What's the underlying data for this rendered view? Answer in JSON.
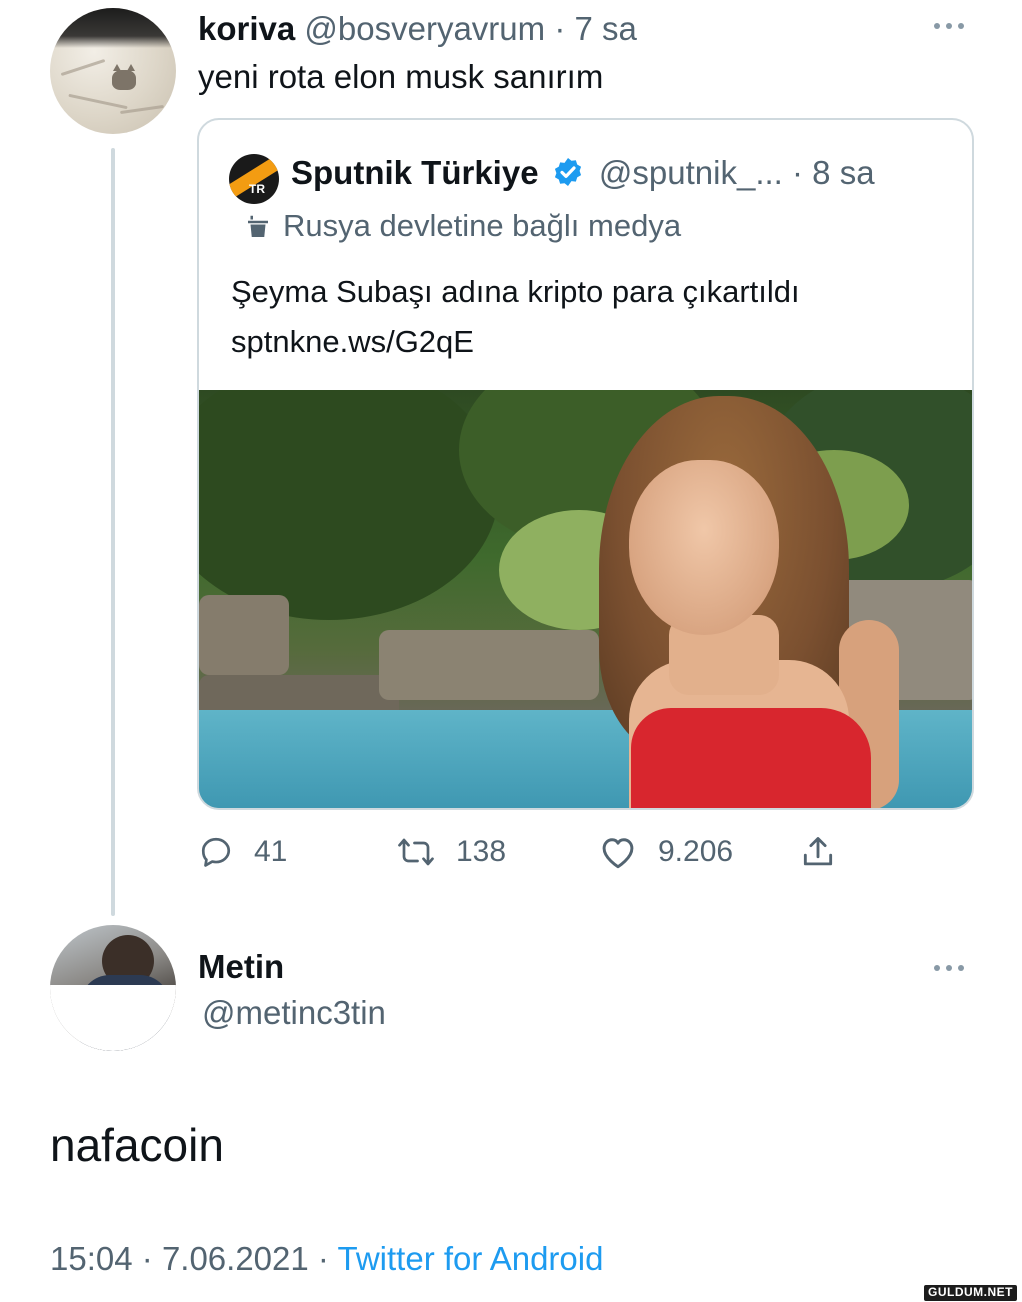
{
  "quoting_tweet": {
    "author_name": "koriva",
    "author_handle": "@bosveryavrum",
    "separator": "·",
    "time": "7 sa",
    "text": "yeni rota elon musk sanırım",
    "avatar_icon": "sleeping-cat-avatar",
    "more_icon": "more-dots-icon"
  },
  "quoted_tweet": {
    "logo_text": "TR",
    "author_name": "Sputnik Türkiye",
    "verified_icon": "verified-badge-icon",
    "author_handle": "@sputnik_...",
    "separator": "·",
    "time": "8 sa",
    "label_icon": "state-media-podium-icon",
    "label": "Rusya devletine bağlı medya",
    "text": "Şeyma Subaşı adına kripto para çıkartıldı",
    "link": "sptnkne.ws/G2qE",
    "image": "woman-red-swimsuit-poolside-photo"
  },
  "actions": {
    "reply_count": "41",
    "retweet_count": "138",
    "like_count": "9.206",
    "icons": [
      "reply-icon",
      "retweet-icon",
      "like-icon",
      "share-icon"
    ]
  },
  "main_tweet": {
    "author_name": "Metin",
    "author_handle": "@metinc3tin",
    "text": "nafacoin",
    "time": "15:04",
    "separator": "·",
    "date": "7.06.2021",
    "separator2": "·",
    "source": "Twitter for Android",
    "more_icon": "more-dots-icon"
  },
  "watermark": "GULDUM.NET",
  "colors": {
    "text": "#0f1419",
    "muted": "#536471",
    "link": "#1d9bf0",
    "border": "#cfd9de",
    "verified": "#1d9bf0"
  }
}
